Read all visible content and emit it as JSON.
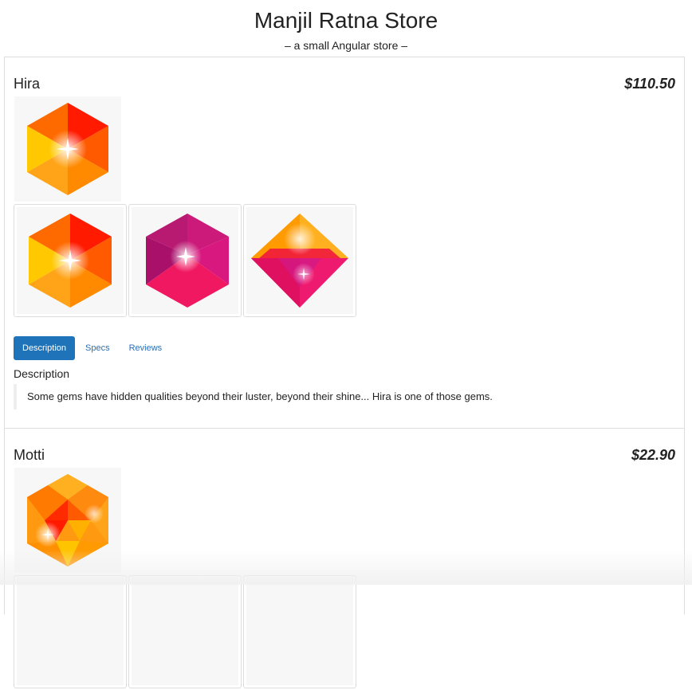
{
  "header": {
    "title": "Manjil Ratna Store",
    "subtitle": "– a small Angular store –"
  },
  "products": [
    {
      "name": "Hira",
      "price": "$110.50",
      "main_image_icon": "orange-hexagon-gem-icon",
      "thumbnails": [
        "orange-hexagon-gem-icon",
        "magenta-hexagon-gem-icon",
        "pink-diamond-gem-icon"
      ],
      "tabs": [
        "Description",
        "Specs",
        "Reviews"
      ],
      "active_tab": "Description",
      "section_heading": "Description",
      "description": "Some gems have hidden qualities beyond their luster, beyond their shine... Hira is one of those gems."
    },
    {
      "name": "Motti",
      "price": "$22.90",
      "main_image_icon": "orange-faceted-gem-icon"
    }
  ],
  "colors": {
    "accent": "#1f74b9",
    "border": "#dddddd",
    "text": "#333333"
  }
}
